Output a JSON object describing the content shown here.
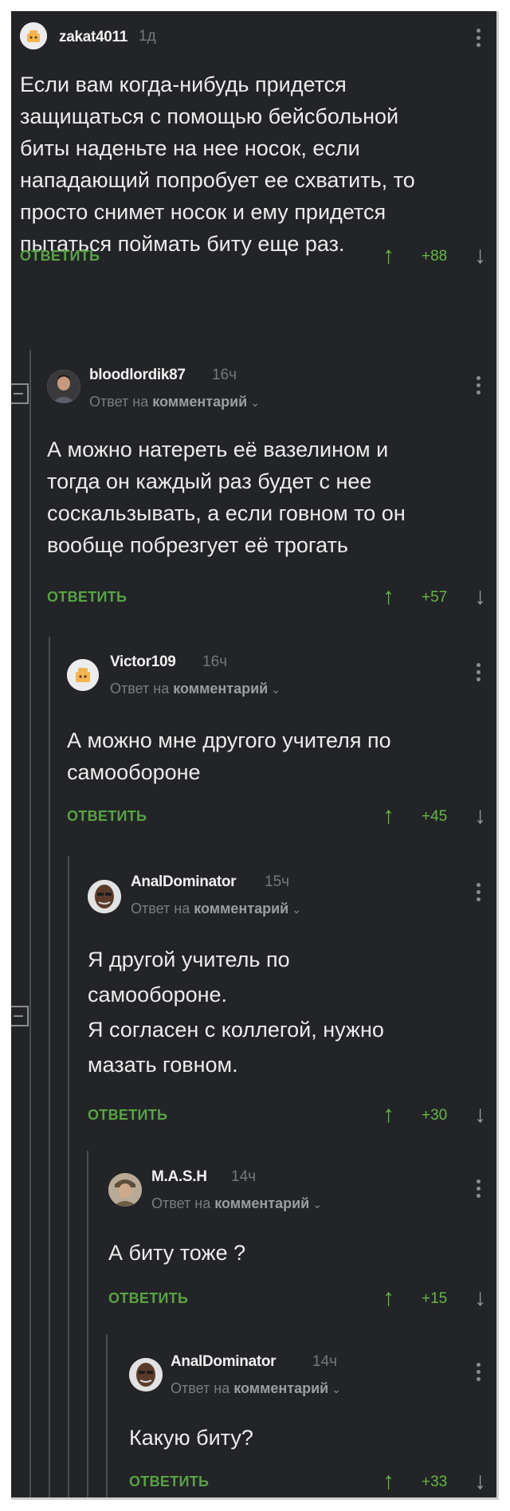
{
  "comments": [
    {
      "username": "zakat4011",
      "time": "1д",
      "body": "Если вам когда-нибудь придется\nзащищаться с помощью бейсбольной\nбиты наденьте на нее носок, если\nнападающий попробует ее схватить, то\nпросто снимет носок и ему придется\nпытаться поймать биту еще раз.",
      "reply_label": "ОТВЕТИТЬ",
      "score": "+88"
    },
    {
      "username": "bloodlordik87",
      "time": "16ч",
      "reply_prefix": "Ответ на ",
      "reply_target": "комментарий",
      "body": "А можно натереть её вазелином и\nтогда он каждый раз будет с нее\nсоскальзывать, а если говном то он\nвообще побрезгует её трогать",
      "reply_label": "ОТВЕТИТЬ",
      "score": "+57"
    },
    {
      "username": "Victor109",
      "time": "16ч",
      "reply_prefix": "Ответ на ",
      "reply_target": "комментарий",
      "body": "А можно мне другого учителя по\nсамообороне",
      "reply_label": "ОТВЕТИТЬ",
      "score": "+45"
    },
    {
      "username": "AnalDominator",
      "time": "15ч",
      "reply_prefix": "Ответ на ",
      "reply_target": "комментарий",
      "body": "Я другой учитель по\nсамообороне.\nЯ согласен с коллегой, нужно\nмазать говном.",
      "reply_label": "ОТВЕТИТЬ",
      "score": "+30"
    },
    {
      "username": "M.A.S.H",
      "time": "14ч",
      "reply_prefix": "Ответ на ",
      "reply_target": "комментарий",
      "body": "А биту тоже ?",
      "reply_label": "ОТВЕТИТЬ",
      "score": "+15"
    },
    {
      "username": "AnalDominator",
      "time": "14ч",
      "reply_prefix": "Ответ на ",
      "reply_target": "комментарий",
      "body": "Какую биту?",
      "reply_label": "ОТВЕТИТЬ",
      "score": "+33"
    }
  ],
  "icons": {
    "upvote": "↑",
    "downvote": "↓",
    "chevron": "⌄"
  },
  "colors": {
    "background": "#232427",
    "accent_green": "#58a344",
    "text": "#ececec"
  }
}
